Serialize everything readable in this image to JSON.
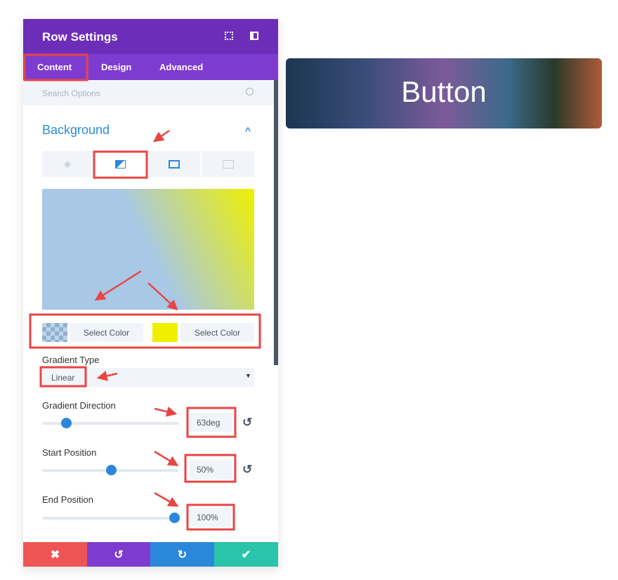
{
  "panel": {
    "title": "Row Settings",
    "icons": [
      "fullscreen-icon",
      "sidebar-toggle-icon"
    ],
    "tabs": [
      {
        "label": "Content",
        "active": true
      },
      {
        "label": "Design"
      },
      {
        "label": "Advanced"
      }
    ],
    "search": {
      "placeholder": "Search Options"
    },
    "section": {
      "title": "Background",
      "expanded": true
    },
    "background_types": [
      "color",
      "gradient",
      "image",
      "video"
    ],
    "active_background_type": "gradient",
    "gradient": {
      "color1": {
        "label": "Select Color",
        "value": "transparent"
      },
      "color2": {
        "label": "Select Color",
        "value": "#eef000"
      },
      "preview_colors": [
        "#a8c8e6",
        "#eef000"
      ],
      "type": {
        "label": "Gradient Type",
        "value": "Linear"
      },
      "direction": {
        "label": "Gradient Direction",
        "value": "63deg",
        "number": 63,
        "max": 360
      },
      "start": {
        "label": "Start Position",
        "value": "50%",
        "number": 50
      },
      "end": {
        "label": "End Position",
        "value": "100%",
        "number": 100
      }
    },
    "footer": {
      "colors": [
        "#ef5555",
        "#7e3bd0",
        "#2b87da",
        "#29c4a9"
      ],
      "actions": [
        "cancel",
        "undo",
        "redo",
        "save"
      ]
    }
  },
  "preview": {
    "button_label": "Button"
  },
  "colors": {
    "header": "#6c2eb9",
    "tabs": "#7e3bd0",
    "accent": "#2b87da",
    "annotation": "#e84545"
  }
}
